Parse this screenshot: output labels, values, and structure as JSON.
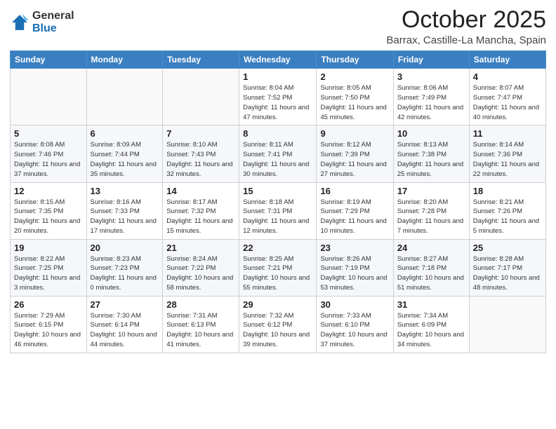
{
  "logo": {
    "general": "General",
    "blue": "Blue"
  },
  "header": {
    "month": "October 2025",
    "location": "Barrax, Castille-La Mancha, Spain"
  },
  "weekdays": [
    "Sunday",
    "Monday",
    "Tuesday",
    "Wednesday",
    "Thursday",
    "Friday",
    "Saturday"
  ],
  "weeks": [
    [
      {
        "day": "",
        "sunrise": "",
        "sunset": "",
        "daylight": ""
      },
      {
        "day": "",
        "sunrise": "",
        "sunset": "",
        "daylight": ""
      },
      {
        "day": "",
        "sunrise": "",
        "sunset": "",
        "daylight": ""
      },
      {
        "day": "1",
        "sunrise": "Sunrise: 8:04 AM",
        "sunset": "Sunset: 7:52 PM",
        "daylight": "Daylight: 11 hours and 47 minutes."
      },
      {
        "day": "2",
        "sunrise": "Sunrise: 8:05 AM",
        "sunset": "Sunset: 7:50 PM",
        "daylight": "Daylight: 11 hours and 45 minutes."
      },
      {
        "day": "3",
        "sunrise": "Sunrise: 8:06 AM",
        "sunset": "Sunset: 7:49 PM",
        "daylight": "Daylight: 11 hours and 42 minutes."
      },
      {
        "day": "4",
        "sunrise": "Sunrise: 8:07 AM",
        "sunset": "Sunset: 7:47 PM",
        "daylight": "Daylight: 11 hours and 40 minutes."
      }
    ],
    [
      {
        "day": "5",
        "sunrise": "Sunrise: 8:08 AM",
        "sunset": "Sunset: 7:46 PM",
        "daylight": "Daylight: 11 hours and 37 minutes."
      },
      {
        "day": "6",
        "sunrise": "Sunrise: 8:09 AM",
        "sunset": "Sunset: 7:44 PM",
        "daylight": "Daylight: 11 hours and 35 minutes."
      },
      {
        "day": "7",
        "sunrise": "Sunrise: 8:10 AM",
        "sunset": "Sunset: 7:43 PM",
        "daylight": "Daylight: 11 hours and 32 minutes."
      },
      {
        "day": "8",
        "sunrise": "Sunrise: 8:11 AM",
        "sunset": "Sunset: 7:41 PM",
        "daylight": "Daylight: 11 hours and 30 minutes."
      },
      {
        "day": "9",
        "sunrise": "Sunrise: 8:12 AM",
        "sunset": "Sunset: 7:39 PM",
        "daylight": "Daylight: 11 hours and 27 minutes."
      },
      {
        "day": "10",
        "sunrise": "Sunrise: 8:13 AM",
        "sunset": "Sunset: 7:38 PM",
        "daylight": "Daylight: 11 hours and 25 minutes."
      },
      {
        "day": "11",
        "sunrise": "Sunrise: 8:14 AM",
        "sunset": "Sunset: 7:36 PM",
        "daylight": "Daylight: 11 hours and 22 minutes."
      }
    ],
    [
      {
        "day": "12",
        "sunrise": "Sunrise: 8:15 AM",
        "sunset": "Sunset: 7:35 PM",
        "daylight": "Daylight: 11 hours and 20 minutes."
      },
      {
        "day": "13",
        "sunrise": "Sunrise: 8:16 AM",
        "sunset": "Sunset: 7:33 PM",
        "daylight": "Daylight: 11 hours and 17 minutes."
      },
      {
        "day": "14",
        "sunrise": "Sunrise: 8:17 AM",
        "sunset": "Sunset: 7:32 PM",
        "daylight": "Daylight: 11 hours and 15 minutes."
      },
      {
        "day": "15",
        "sunrise": "Sunrise: 8:18 AM",
        "sunset": "Sunset: 7:31 PM",
        "daylight": "Daylight: 11 hours and 12 minutes."
      },
      {
        "day": "16",
        "sunrise": "Sunrise: 8:19 AM",
        "sunset": "Sunset: 7:29 PM",
        "daylight": "Daylight: 11 hours and 10 minutes."
      },
      {
        "day": "17",
        "sunrise": "Sunrise: 8:20 AM",
        "sunset": "Sunset: 7:28 PM",
        "daylight": "Daylight: 11 hours and 7 minutes."
      },
      {
        "day": "18",
        "sunrise": "Sunrise: 8:21 AM",
        "sunset": "Sunset: 7:26 PM",
        "daylight": "Daylight: 11 hours and 5 minutes."
      }
    ],
    [
      {
        "day": "19",
        "sunrise": "Sunrise: 8:22 AM",
        "sunset": "Sunset: 7:25 PM",
        "daylight": "Daylight: 11 hours and 3 minutes."
      },
      {
        "day": "20",
        "sunrise": "Sunrise: 8:23 AM",
        "sunset": "Sunset: 7:23 PM",
        "daylight": "Daylight: 11 hours and 0 minutes."
      },
      {
        "day": "21",
        "sunrise": "Sunrise: 8:24 AM",
        "sunset": "Sunset: 7:22 PM",
        "daylight": "Daylight: 10 hours and 58 minutes."
      },
      {
        "day": "22",
        "sunrise": "Sunrise: 8:25 AM",
        "sunset": "Sunset: 7:21 PM",
        "daylight": "Daylight: 10 hours and 55 minutes."
      },
      {
        "day": "23",
        "sunrise": "Sunrise: 8:26 AM",
        "sunset": "Sunset: 7:19 PM",
        "daylight": "Daylight: 10 hours and 53 minutes."
      },
      {
        "day": "24",
        "sunrise": "Sunrise: 8:27 AM",
        "sunset": "Sunset: 7:18 PM",
        "daylight": "Daylight: 10 hours and 51 minutes."
      },
      {
        "day": "25",
        "sunrise": "Sunrise: 8:28 AM",
        "sunset": "Sunset: 7:17 PM",
        "daylight": "Daylight: 10 hours and 48 minutes."
      }
    ],
    [
      {
        "day": "26",
        "sunrise": "Sunrise: 7:29 AM",
        "sunset": "Sunset: 6:15 PM",
        "daylight": "Daylight: 10 hours and 46 minutes."
      },
      {
        "day": "27",
        "sunrise": "Sunrise: 7:30 AM",
        "sunset": "Sunset: 6:14 PM",
        "daylight": "Daylight: 10 hours and 44 minutes."
      },
      {
        "day": "28",
        "sunrise": "Sunrise: 7:31 AM",
        "sunset": "Sunset: 6:13 PM",
        "daylight": "Daylight: 10 hours and 41 minutes."
      },
      {
        "day": "29",
        "sunrise": "Sunrise: 7:32 AM",
        "sunset": "Sunset: 6:12 PM",
        "daylight": "Daylight: 10 hours and 39 minutes."
      },
      {
        "day": "30",
        "sunrise": "Sunrise: 7:33 AM",
        "sunset": "Sunset: 6:10 PM",
        "daylight": "Daylight: 10 hours and 37 minutes."
      },
      {
        "day": "31",
        "sunrise": "Sunrise: 7:34 AM",
        "sunset": "Sunset: 6:09 PM",
        "daylight": "Daylight: 10 hours and 34 minutes."
      },
      {
        "day": "",
        "sunrise": "",
        "sunset": "",
        "daylight": ""
      }
    ]
  ]
}
